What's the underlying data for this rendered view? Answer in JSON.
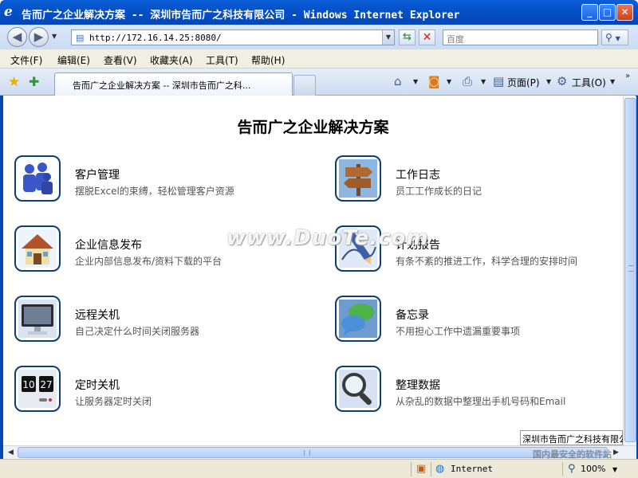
{
  "window": {
    "title": "告而广之企业解决方案 -- 深圳市告而广之科技有限公司 - Windows Internet Explorer",
    "minimize": "_",
    "maximize": "□",
    "close": "✕"
  },
  "address": {
    "url": "http://172.16.14.25:8080/",
    "search_placeholder": "百度"
  },
  "menu": [
    {
      "label": "文件(F)"
    },
    {
      "label": "编辑(E)"
    },
    {
      "label": "查看(V)"
    },
    {
      "label": "收藏夹(A)"
    },
    {
      "label": "工具(T)"
    },
    {
      "label": "帮助(H)"
    }
  ],
  "tab": {
    "title": "告而广之企业解决方案 -- 深圳市告而广之科..."
  },
  "commands": {
    "page": "页面(P)",
    "tools": "工具(O)"
  },
  "page": {
    "title": "告而广之企业解决方案",
    "watermark": "www.DuoTe.com",
    "company_select": "深圳市告而广之科技有限公司",
    "apps": [
      {
        "name": "客户管理",
        "desc": "摆脱Excel的束缚，轻松管理客户资源",
        "icon": "users-icon"
      },
      {
        "name": "工作日志",
        "desc": "员工工作成长的日记",
        "icon": "signpost-icon"
      },
      {
        "name": "企业信息发布",
        "desc": "企业内部信息发布/资料下载的平台",
        "icon": "house-icon"
      },
      {
        "name": "计划报告",
        "desc": "有条不紊的推进工作，科学合理的安排时间",
        "icon": "pencil-icon"
      },
      {
        "name": "远程关机",
        "desc": "自己决定什么时间关闭服务器",
        "icon": "monitor-icon"
      },
      {
        "name": "备忘录",
        "desc": "不用担心工作中遗漏重要事项",
        "icon": "chat-bubbles-icon"
      },
      {
        "name": "定时关机",
        "desc": "让服务器定时关闭",
        "icon": "flip-clock-icon"
      },
      {
        "name": "整理数据",
        "desc": "从杂乱的数据中整理出手机号码和Email",
        "icon": "magnifier-icon"
      }
    ]
  },
  "status": {
    "zone": "Internet",
    "zoom": "100%",
    "brand": "国内最安全的软件站"
  }
}
